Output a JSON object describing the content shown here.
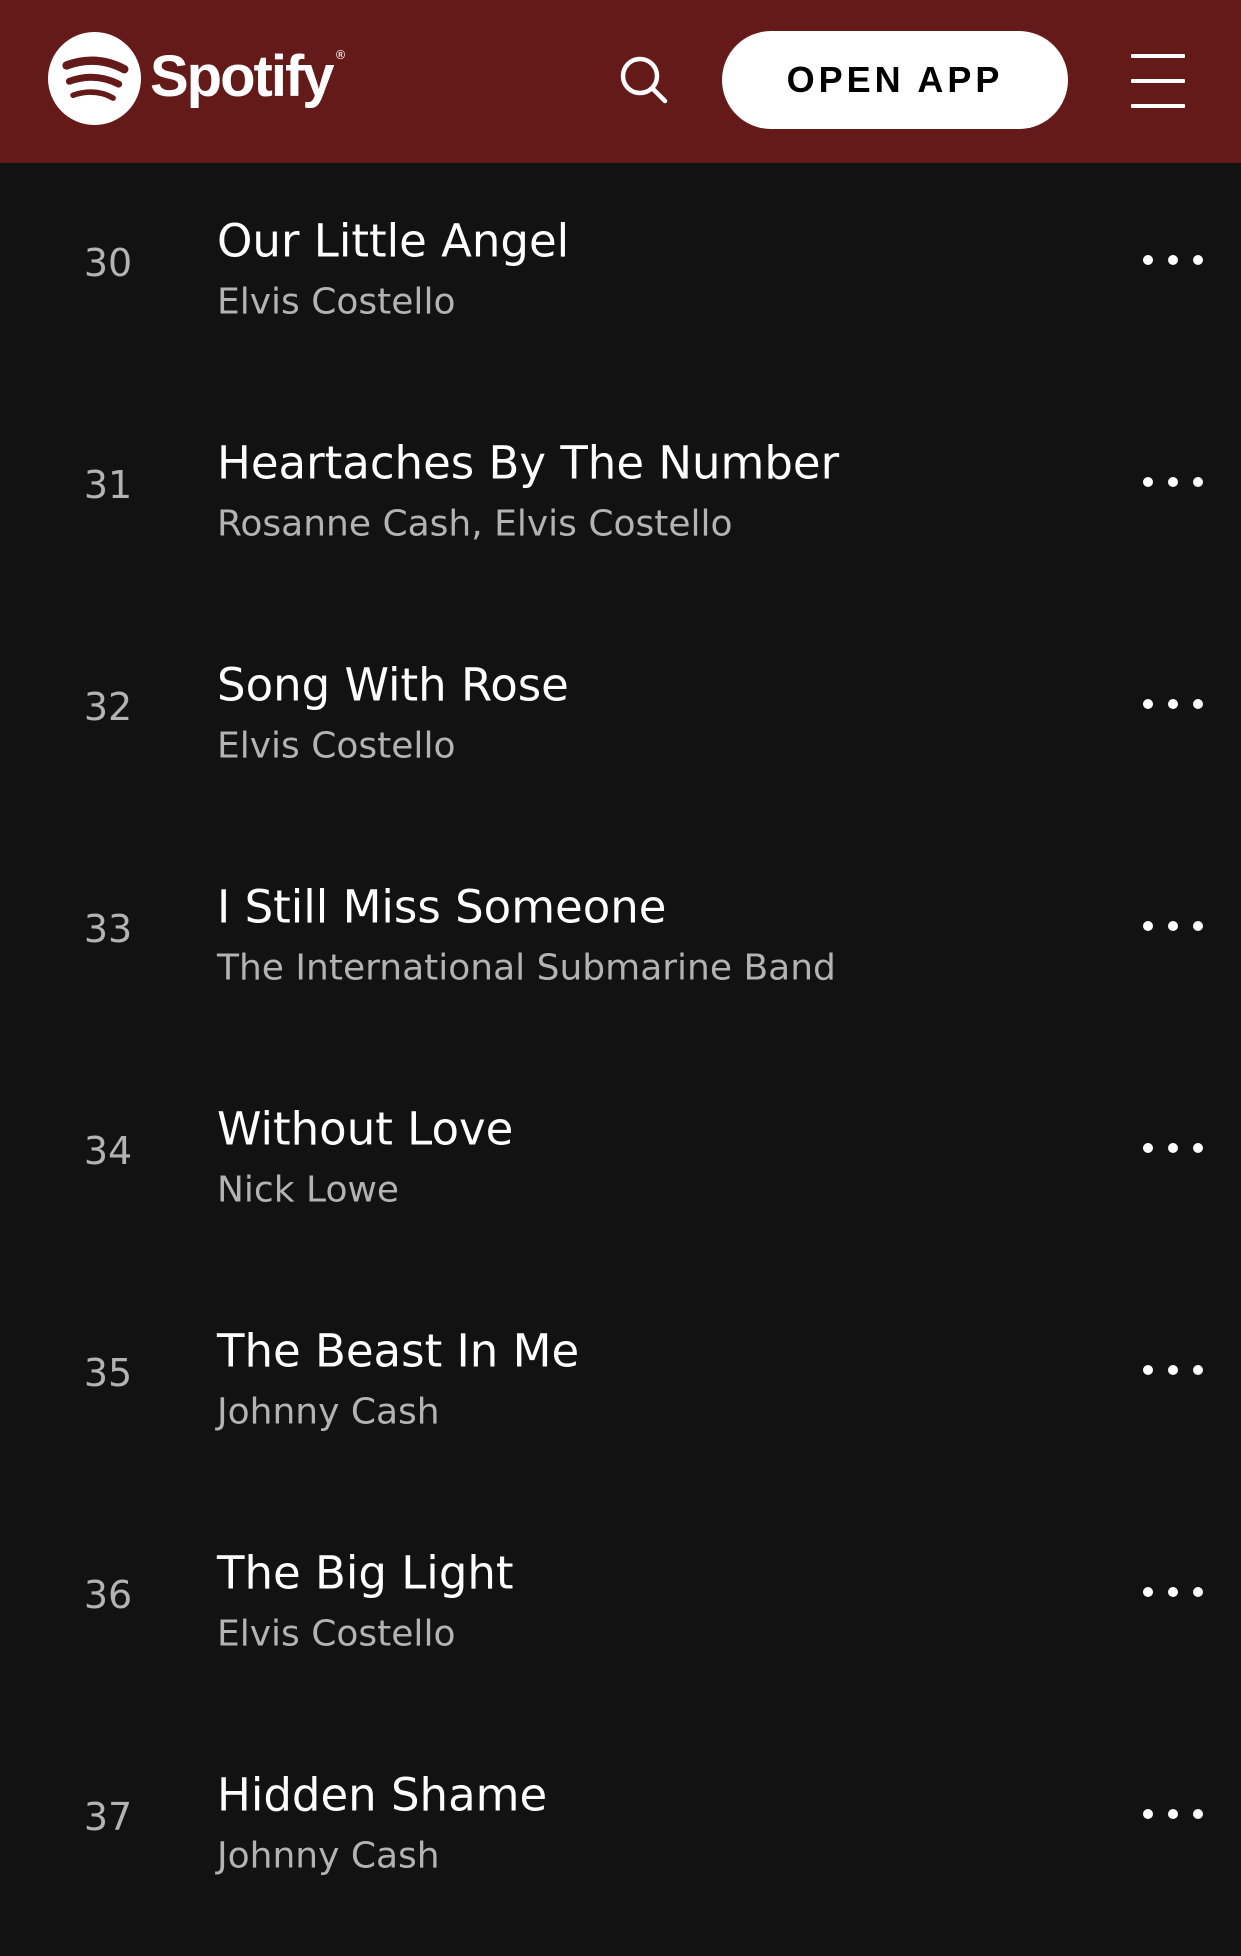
{
  "header": {
    "brand": "Spotify",
    "brand_mark": "®",
    "logo_icon": "spotify-logo-icon",
    "search_icon": "search-icon",
    "open_app_label": "OPEN APP",
    "menu_icon": "hamburger-menu-icon",
    "background_color": "#651a1a"
  },
  "tracks": [
    {
      "number": "30",
      "title": "Our Little Angel",
      "artist": "Elvis Costello"
    },
    {
      "number": "31",
      "title": "Heartaches By The Number",
      "artist": "Rosanne Cash, Elvis Costello"
    },
    {
      "number": "32",
      "title": "Song With Rose",
      "artist": "Elvis Costello"
    },
    {
      "number": "33",
      "title": "I Still Miss Someone",
      "artist": "The International Submarine Band"
    },
    {
      "number": "34",
      "title": "Without Love",
      "artist": "Nick Lowe"
    },
    {
      "number": "35",
      "title": "The Beast In Me",
      "artist": "Johnny Cash"
    },
    {
      "number": "36",
      "title": "The Big Light",
      "artist": "Elvis Costello"
    },
    {
      "number": "37",
      "title": "Hidden Shame",
      "artist": "Johnny Cash"
    }
  ],
  "more_icon": "more-options-icon"
}
